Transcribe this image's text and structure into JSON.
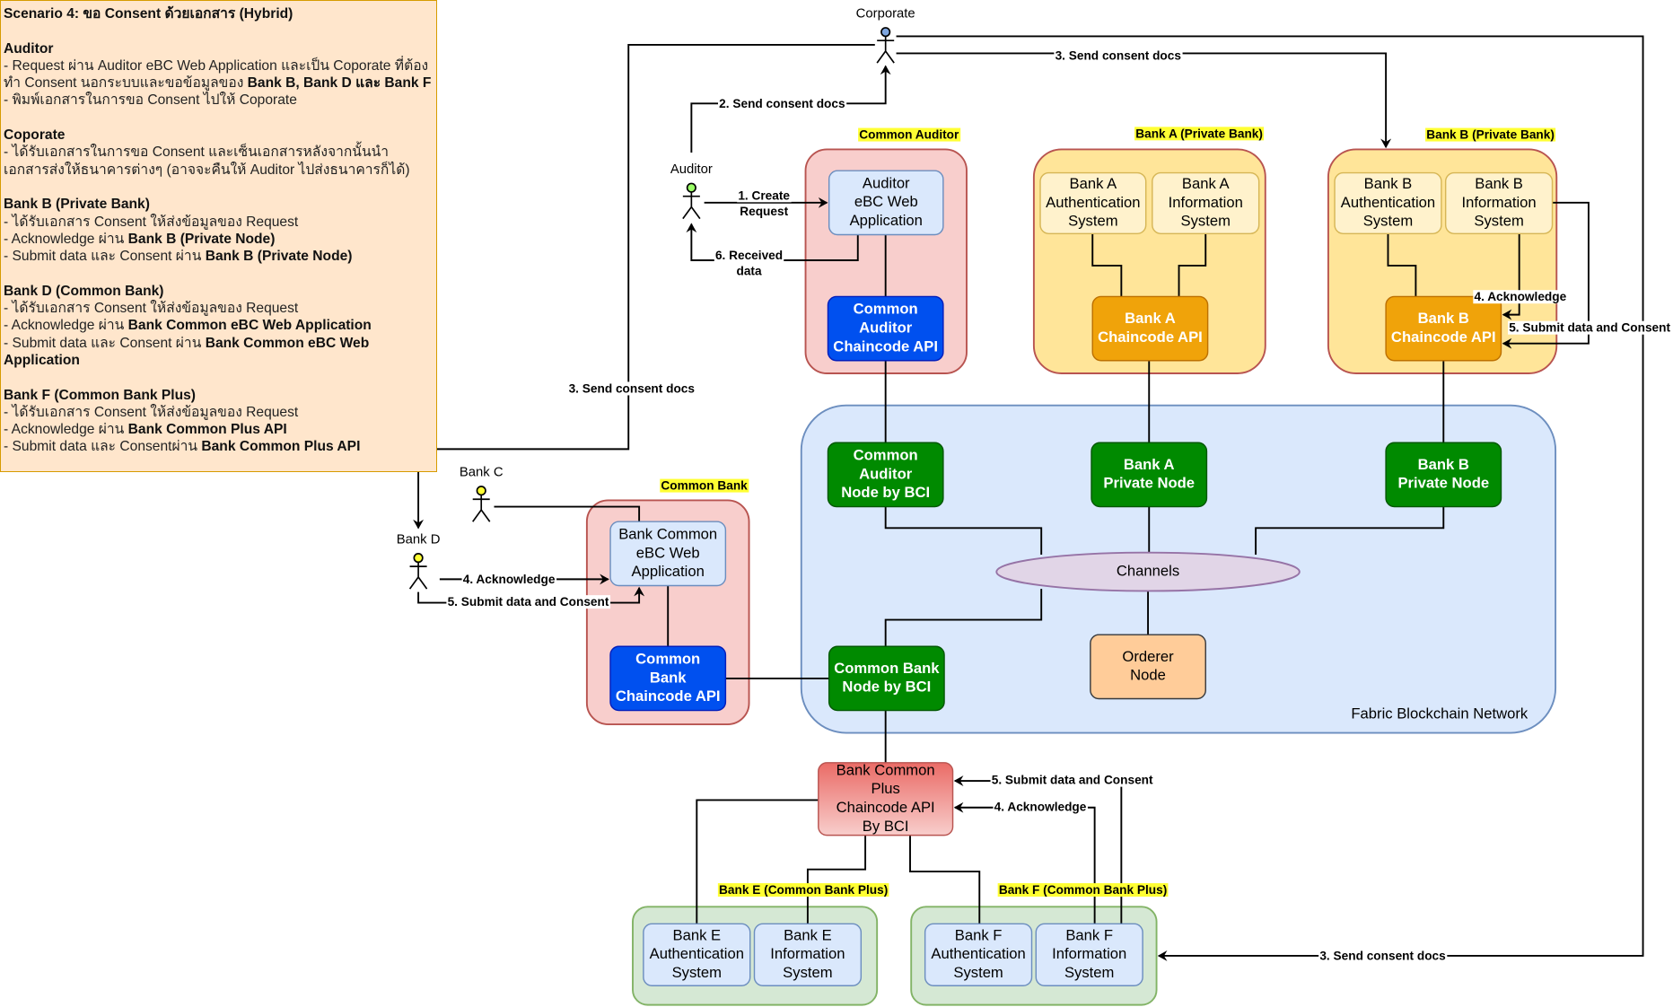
{
  "notes": {
    "title": "Scenario 4: ขอ Consent ด้วยเอกสาร (Hybrid)",
    "sections": [
      {
        "heading": "Auditor",
        "items": [
          [
            {
              "text": "- Request ผ่าน Auditor eBC Web Application และเป็น Coporate ที่ต้องทำ Consent นอกระบบและขอข้อมูลของ ",
              "bold": false
            },
            {
              "text": "Bank B, Bank D และ Bank F",
              "bold": true
            }
          ],
          [
            {
              "text": "- พิมพ์เอกสารในการขอ Consent ไปให้ Coporate",
              "bold": false
            }
          ]
        ]
      },
      {
        "heading": "Coporate",
        "items": [
          [
            {
              "text": "- ได้รับเอกสารในการขอ Consent และเซ็นเอกสารหลังจากนั้นนำเอกสารส่งให้ธนาคารต่างๆ (อาจจะคืนให้ Auditor ไปส่งธนาคารก็ได้)",
              "bold": false
            }
          ]
        ]
      },
      {
        "heading": "Bank B (Private Bank)",
        "items": [
          [
            {
              "text": "- ได้รับเอกสาร Consent ให้ส่งข้อมูลของ Request",
              "bold": false
            }
          ],
          [
            {
              "text": "- Acknowledge ผ่าน ",
              "bold": false
            },
            {
              "text": "Bank B (Private Node)",
              "bold": true
            }
          ],
          [
            {
              "text": "- Submit data และ Consent ผ่าน ",
              "bold": false
            },
            {
              "text": "Bank B (Private Node)",
              "bold": true
            }
          ]
        ]
      },
      {
        "heading": "Bank D (Common Bank)",
        "items": [
          [
            {
              "text": "- ได้รับเอกสาร Consent ให้ส่งข้อมูลของ Request",
              "bold": false
            }
          ],
          [
            {
              "text": "- Acknowledge ผ่าน ",
              "bold": false
            },
            {
              "text": "Bank Common eBC Web Application",
              "bold": true
            }
          ],
          [
            {
              "text": "- Submit data และ Consent ผ่าน ",
              "bold": false
            },
            {
              "text": "Bank Common eBC Web Application",
              "bold": true
            }
          ]
        ]
      },
      {
        "heading": "Bank F (Common Bank Plus)",
        "items": [
          [
            {
              "text": "- ได้รับเอกสาร Consent ให้ส่งข้อมูลของ Request",
              "bold": false
            }
          ],
          [
            {
              "text": "- Acknowledge ผ่าน ",
              "bold": false
            },
            {
              "text": "Bank Common Plus API",
              "bold": true
            }
          ],
          [
            {
              "text": "- Submit data และ Consentผ่าน ",
              "bold": false
            },
            {
              "text": "Bank Common Plus API",
              "bold": true
            }
          ]
        ]
      }
    ]
  },
  "colors": {
    "highlight": "#ffff33",
    "pink_fill": "#f8cecc",
    "pink_stroke": "#b85450",
    "private_fill": "#ffe599",
    "network_fill": "#dae8fc",
    "network_stroke": "#6c8ebf",
    "green_fill": "#d5e8d4",
    "green_stroke": "#82b366",
    "blue": "#0050ef",
    "orange": "#f0a30a",
    "node_green": "#008a00"
  },
  "actors": {
    "corporate": {
      "label": "Corporate",
      "head": "#7ea6e0"
    },
    "auditor": {
      "label": "Auditor",
      "head": "#99ff66"
    },
    "bank_c": {
      "label": "Bank C",
      "head": "#ffff33"
    },
    "bank_d": {
      "label": "Bank D",
      "head": "#ffff33"
    }
  },
  "containers": {
    "common_auditor": {
      "label": "Common Auditor"
    },
    "bank_a": {
      "label": "Bank A (Private Bank)"
    },
    "bank_b": {
      "label": "Bank B (Private Bank)"
    },
    "fabric": {
      "label": "Fabric Blockchain Network"
    },
    "common_bank": {
      "label": "Common Bank"
    },
    "bank_e": {
      "label": "Bank E (Common Bank Plus)"
    },
    "bank_f": {
      "label": "Bank F (Common Bank Plus)"
    }
  },
  "nodes": {
    "auditor_web": {
      "lines": [
        "Auditor",
        "eBC Web",
        "Application"
      ]
    },
    "common_auditor_api": {
      "lines": [
        "Common",
        "Auditor",
        "Chaincode API"
      ]
    },
    "bank_a_auth": {
      "lines": [
        "Bank A",
        "Authentication",
        "System"
      ]
    },
    "bank_a_info": {
      "lines": [
        "Bank A",
        "Information",
        "System"
      ]
    },
    "bank_a_api": {
      "lines": [
        "Bank A",
        "Chaincode API"
      ]
    },
    "bank_b_auth": {
      "lines": [
        "Bank B",
        "Authentication",
        "System"
      ]
    },
    "bank_b_info": {
      "lines": [
        "Bank B",
        "Information",
        "System"
      ]
    },
    "bank_b_api": {
      "lines": [
        "Bank B",
        "Chaincode API"
      ]
    },
    "common_auditor_node": {
      "lines": [
        "Common",
        "Auditor",
        "Node by BCI"
      ]
    },
    "bank_a_node": {
      "lines": [
        "Bank A",
        "Private Node"
      ]
    },
    "bank_b_node": {
      "lines": [
        "Bank B",
        "Private Node"
      ]
    },
    "channels": {
      "lines": [
        "Channels"
      ]
    },
    "orderer": {
      "lines": [
        "Orderer",
        "Node"
      ]
    },
    "common_bank_node": {
      "lines": [
        "Common Bank",
        "Node by BCI"
      ]
    },
    "bank_common_web": {
      "lines": [
        "Bank Common",
        "eBC Web",
        "Application"
      ]
    },
    "common_bank_api": {
      "lines": [
        "Common",
        "Bank",
        "Chaincode API"
      ]
    },
    "plus_api": {
      "lines": [
        "Bank Common",
        "Plus",
        "Chaincode API",
        "By BCI"
      ]
    },
    "bank_e_auth": {
      "lines": [
        "Bank E",
        "Authentication",
        "System"
      ]
    },
    "bank_e_info": {
      "lines": [
        "Bank E",
        "Information",
        "System"
      ]
    },
    "bank_f_auth": {
      "lines": [
        "Bank F",
        "Authentication",
        "System"
      ]
    },
    "bank_f_info": {
      "lines": [
        "Bank F",
        "Information",
        "System"
      ]
    }
  },
  "edge_labels": {
    "corp_to_bank_b": [
      "3. Send consent docs"
    ],
    "corp_to_bank_f": [
      "3. Send consent docs"
    ],
    "corp_to_bank_d": [
      "3. Send consent docs"
    ],
    "auditor_to_corp": [
      "2. Send consent docs"
    ],
    "create_request": [
      "1. Create",
      "Request"
    ],
    "received_data": [
      "6. Received",
      "data"
    ],
    "bank_b_ack": [
      "4. Acknowledge"
    ],
    "bank_b_submit": [
      "5. Submit data and Consent"
    ],
    "bank_d_ack": [
      "4. Acknowledge"
    ],
    "bank_d_submit": [
      "5. Submit data and Consent"
    ],
    "bank_f_ack": [
      "4. Acknowledge"
    ],
    "bank_f_submit": [
      "5. Submit data and Consent"
    ]
  }
}
